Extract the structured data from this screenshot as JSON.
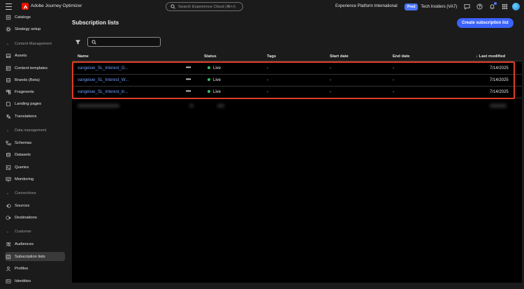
{
  "header": {
    "app_name": "Adobe Journey Optimizer",
    "search_placeholder": "Search Experience Cloud (⌘+/)",
    "org_name": "Experience Platform International",
    "sandbox_badge": "Prod",
    "sandbox_name": "Tech Insiders (VA7)"
  },
  "sidebar": {
    "items": [
      {
        "label": "Catalogs",
        "icon": "catalog-icon"
      },
      {
        "label": "Strategy setup",
        "icon": "gear-icon"
      },
      {
        "section": "Content Management"
      },
      {
        "label": "Assets",
        "icon": "assets-icon"
      },
      {
        "label": "Content templates",
        "icon": "template-icon"
      },
      {
        "label": "Brands (Beta)",
        "icon": "brand-icon"
      },
      {
        "label": "Fragments",
        "icon": "fragment-icon"
      },
      {
        "label": "Landing pages",
        "icon": "landing-page-icon"
      },
      {
        "label": "Translations",
        "icon": "translate-icon"
      },
      {
        "section": "Data management"
      },
      {
        "label": "Schemas",
        "icon": "schema-icon"
      },
      {
        "label": "Datasets",
        "icon": "dataset-icon"
      },
      {
        "label": "Queries",
        "icon": "query-icon"
      },
      {
        "label": "Monitoring",
        "icon": "monitoring-icon"
      },
      {
        "section": "Connections"
      },
      {
        "label": "Sources",
        "icon": "sources-icon"
      },
      {
        "label": "Destinations",
        "icon": "destinations-icon"
      },
      {
        "section": "Customer"
      },
      {
        "label": "Audiences",
        "icon": "audiences-icon"
      },
      {
        "label": "Subscription lists",
        "icon": "subscription-icon",
        "active": true
      },
      {
        "label": "Profiles",
        "icon": "profile-icon"
      },
      {
        "label": "Identities",
        "icon": "identity-icon"
      }
    ]
  },
  "main": {
    "title": "Subscription lists",
    "create_button": "Create subscription list",
    "columns": [
      "Name",
      "Status",
      "Tags",
      "Start date",
      "End date",
      "Last modified"
    ],
    "sort_indicator": "↓",
    "rows": [
      {
        "name": "vangeluw_SL_Interest_O...",
        "status": "Live",
        "tags": "-",
        "start": "-",
        "end": "-",
        "modified": "7/14/2025"
      },
      {
        "name": "vangeluw_SL_Interest_W...",
        "status": "Live",
        "tags": "-",
        "start": "-",
        "end": "-",
        "modified": "7/14/2025"
      },
      {
        "name": "vangeluw_SL_Interest_in...",
        "status": "Live",
        "tags": "-",
        "start": "-",
        "end": "-",
        "modified": "7/14/2025"
      }
    ],
    "more_label": "•••",
    "colors": {
      "accent": "#3b63fb",
      "live": "#2dc26b",
      "highlight": "#e03c24",
      "link": "#6e9cff"
    }
  }
}
